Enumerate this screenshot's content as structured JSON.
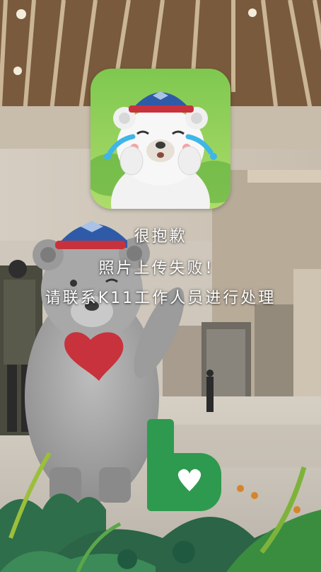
{
  "dialog": {
    "icon": "crying-bear-icon",
    "line1": "很抱歉",
    "line2": "照片上传失败！",
    "line3": "请联系K11工作人员进行处理"
  },
  "colors": {
    "text": "#ffffff",
    "icon_bg": "#8fcf5a",
    "brand_green": "#2e9a4f",
    "heart": "#c8323c",
    "cap": "#2f5aa8"
  }
}
